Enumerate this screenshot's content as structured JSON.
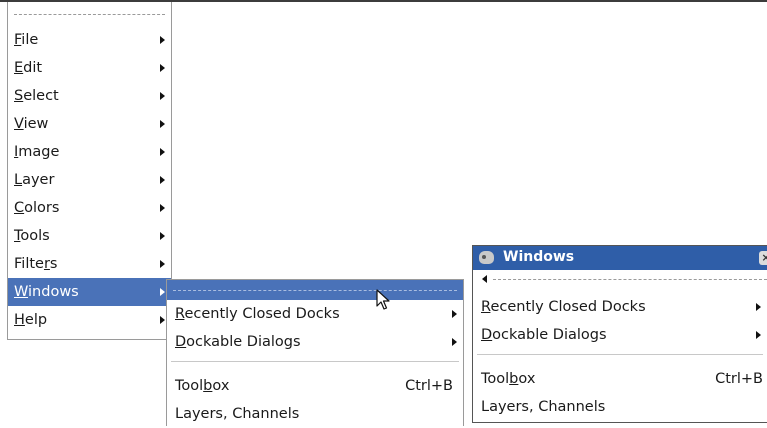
{
  "main_menu": {
    "items": [
      {
        "label": "File",
        "mnemonic": "F",
        "rest": "ile"
      },
      {
        "label": "Edit",
        "mnemonic": "E",
        "rest": "dit"
      },
      {
        "label": "Select",
        "mnemonic": "S",
        "rest": "elect"
      },
      {
        "label": "View",
        "mnemonic": "V",
        "rest": "iew"
      },
      {
        "label": "Image",
        "mnemonic": "I",
        "rest": "mage"
      },
      {
        "label": "Layer",
        "mnemonic": "L",
        "rest": "ayer"
      },
      {
        "label": "Colors",
        "mnemonic": "C",
        "rest": "olors"
      },
      {
        "label": "Tools",
        "mnemonic": "T",
        "rest": "ools"
      },
      {
        "label": "Filters",
        "pre": "Filte",
        "mnemonic": "r",
        "rest": "s"
      },
      {
        "label": "Windows",
        "mnemonic": "W",
        "rest": "indows"
      },
      {
        "label": "Help",
        "mnemonic": "H",
        "rest": "elp"
      }
    ],
    "active_item": "Windows"
  },
  "windows_submenu": {
    "recently_closed": {
      "mnemonic": "R",
      "rest": "ecently Closed Docks"
    },
    "dockable_dialogs": {
      "mnemonic": "D",
      "rest": "ockable Dialogs"
    },
    "toolbox": {
      "pre": "Tool",
      "mnemonic": "b",
      "rest": "ox",
      "shortcut": "Ctrl+B"
    },
    "layers_channels": "Layers, Channels"
  },
  "torn_off_window": {
    "title": "Windows",
    "close_glyph": "×",
    "recently_closed": {
      "mnemonic": "R",
      "rest": "ecently Closed Docks"
    },
    "dockable_dialogs": {
      "mnemonic": "D",
      "rest": "ockable Dialogs"
    },
    "toolbox": {
      "pre": "Tool",
      "mnemonic": "b",
      "rest": "ox",
      "shortcut": "Ctrl+B"
    },
    "layers_channels": "Layers, Channels"
  },
  "colors": {
    "highlight": "#4a72b8",
    "titlebar": "#2f5ea8"
  }
}
